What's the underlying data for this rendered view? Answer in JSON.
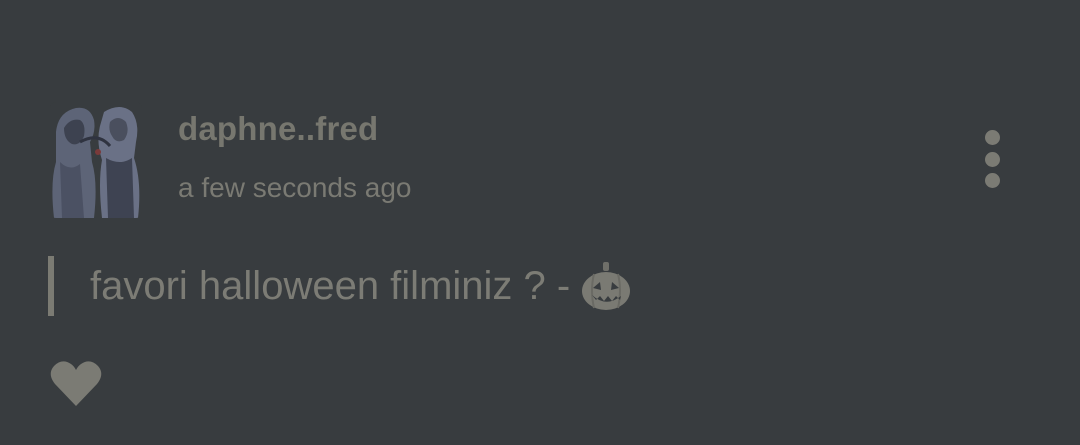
{
  "post": {
    "author": {
      "username": "daphne..fred",
      "avatar_icon": "photo-avatar"
    },
    "timestamp": "a few seconds ago",
    "content": {
      "text": "favori halloween filminiz ? -",
      "emoji_icon": "jack-o-lantern-icon"
    },
    "actions": {
      "more_icon": "vertical-ellipsis-icon",
      "like_icon": "heart-icon"
    }
  },
  "colors": {
    "background": "#383c3f",
    "text": "#7a7a73",
    "avatar_tint": "#5d6477"
  }
}
